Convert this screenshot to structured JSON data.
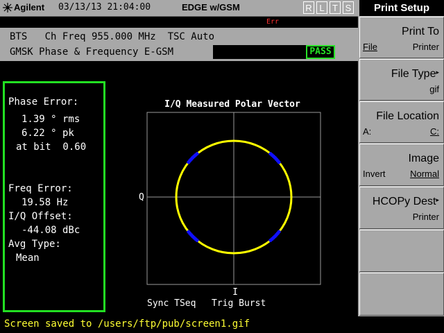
{
  "header": {
    "brand": "Agilent",
    "datetime": "03/13/13 21:04:00",
    "mode": "EDGE w/GSM",
    "flags": [
      "R",
      "L",
      "T",
      "S"
    ],
    "error_indicator": "Err"
  },
  "info": {
    "line1": "BTS   Ch Freq 955.000 MHz  TSC Auto",
    "line2": "GMSK Phase & Frequency E-GSM",
    "result": "PASS"
  },
  "results": {
    "phase_error_label": "Phase Error:",
    "phase_rms": "1.39 ° rms",
    "phase_pk": "6.22 ° pk",
    "at_bit": "at bit  0.60",
    "freq_error_label": "Freq Error:",
    "freq_error_value": "19.58 Hz",
    "iq_offset_label": "I/Q Offset:",
    "iq_offset_value": "-44.08 dBc",
    "avg_type_label": "Avg Type:",
    "avg_type_value": "Mean"
  },
  "chart": {
    "title": "I/Q Measured Polar Vector",
    "q_label": "Q",
    "i_label": "I",
    "sync_label": "Sync TSeq",
    "trig_label": "Trig Burst",
    "ring_color": "#ffff00",
    "point_color": "#1010ff"
  },
  "chart_data": {
    "type": "scatter",
    "title": "I/Q Measured Polar Vector",
    "xlabel": "I",
    "ylabel": "Q",
    "series": [
      {
        "points": [
          [
            0.707,
            0.707
          ],
          [
            -0.707,
            0.707
          ],
          [
            -0.707,
            -0.707
          ],
          [
            0.707,
            -0.707
          ]
        ]
      }
    ],
    "xlim": [
      -1.2,
      1.2
    ],
    "ylim": [
      -1.2,
      1.2
    ],
    "grid": true
  },
  "menu": {
    "title": "Print Setup",
    "keys": [
      {
        "title": "Print To",
        "left": "File",
        "right": "Printer"
      },
      {
        "title": "File Type",
        "left": "",
        "right": "gif"
      },
      {
        "title": "File Location",
        "left": "A:",
        "right": "C:"
      },
      {
        "title": "Image",
        "left": "Invert",
        "right": "Normal"
      },
      {
        "title": "HCOPy Dest",
        "left": "",
        "right": "Printer"
      }
    ]
  },
  "status": {
    "message": "Screen saved to /users/ftp/pub/screen1.gif"
  }
}
